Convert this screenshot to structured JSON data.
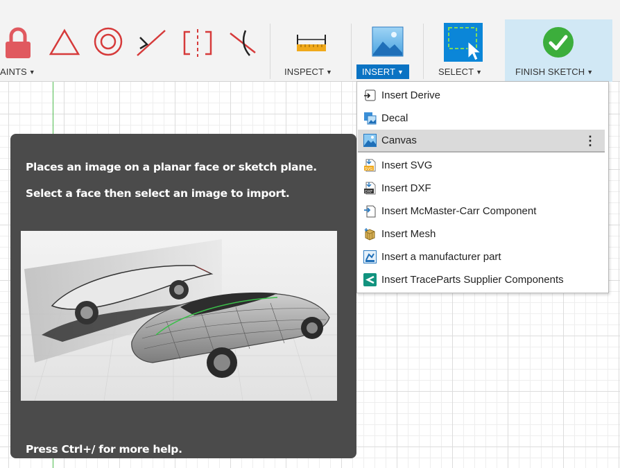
{
  "toolbar": {
    "constraints_label": "AINTS",
    "inspect_label": "INSPECT",
    "insert_label": "INSERT",
    "select_label": "SELECT",
    "finish_label": "FINISH SKETCH",
    "colors": {
      "accent": "#0b73c3",
      "finish_bg": "#d1e8f5",
      "check": "#3cae3c",
      "lock": "#e0595f"
    }
  },
  "tooltip": {
    "line1": "Places an image on a planar face or sketch plane.",
    "line2": "Select a face then select an image to import.",
    "help": "Press Ctrl+/ for more help."
  },
  "menu": {
    "items": [
      {
        "label": "Insert Derive",
        "icon": "insert-derive-icon"
      },
      {
        "label": "Decal",
        "icon": "decal-icon"
      },
      {
        "label": "Canvas",
        "icon": "canvas-icon",
        "selected": true
      },
      {
        "label": "Insert SVG",
        "icon": "svg-file-icon"
      },
      {
        "label": "Insert DXF",
        "icon": "dxf-file-icon"
      },
      {
        "label": "Insert McMaster-Carr Component",
        "icon": "mcmaster-icon"
      },
      {
        "label": "Insert Mesh",
        "icon": "mesh-icon"
      },
      {
        "label": "Insert a manufacturer part",
        "icon": "manufacturer-part-icon"
      },
      {
        "label": "Insert TraceParts Supplier Components",
        "icon": "traceparts-icon"
      }
    ]
  }
}
